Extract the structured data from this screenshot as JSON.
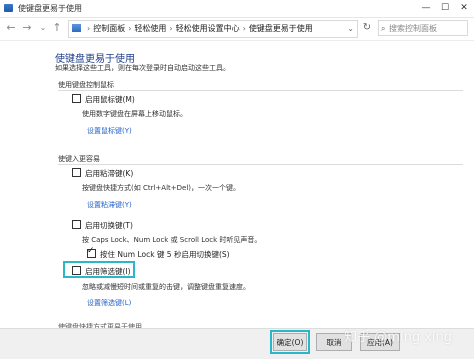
{
  "window": {
    "title": "使键盘更易于使用",
    "minimize": "—",
    "maximize": "☐",
    "close": "✕"
  },
  "nav": {
    "back_icon": "arrow-left-icon",
    "forward_icon": "arrow-right-icon",
    "up_icon": "arrow-up-icon",
    "breadcrumb": [
      "控制面板",
      "轻松使用",
      "轻松使用设置中心",
      "使键盘更易于使用"
    ],
    "search_placeholder": "搜索控制面板"
  },
  "main": {
    "title": "使键盘更易于使用",
    "subtitle": "如果选择这些工具，则在每次登录时自动启动这些工具。",
    "section_mouse": {
      "heading": "使用键盘控制鼠标",
      "checkbox": {
        "label": "启用鼠标键(M)",
        "checked": false
      },
      "desc": "使用数字键盘在屏幕上移动鼠标。",
      "link": "设置鼠标键(Y)"
    },
    "section_typing": {
      "heading": "使键入更容易",
      "sticky": {
        "label": "启用粘滞键(K)",
        "checked": false,
        "desc": "按键盘快捷方式(如 Ctrl+Alt+Del)，一次一个键。",
        "link": "设置粘滞键(Y)"
      },
      "toggle": {
        "label": "启用切换键(T)",
        "checked": false,
        "desc": "按 Caps Lock、Num Lock 或 Scroll Lock 时听见声音。",
        "sub_label": "按住 Num Lock 键 5 秒启用切换键(S)",
        "sub_checked": true
      },
      "filter": {
        "label": "启用筛选键(I)",
        "checked": false,
        "desc": "忽略或减慢短时间或重复的击键，调整键盘重复速度。",
        "link": "设置筛选键(L)"
      }
    },
    "next_section_heading": "使键盘快捷方式更易于使用"
  },
  "buttons": {
    "ok": "确定(O)",
    "cancel": "取消",
    "apply": "应用(A)"
  },
  "watermark": "知乎 @ming xing"
}
